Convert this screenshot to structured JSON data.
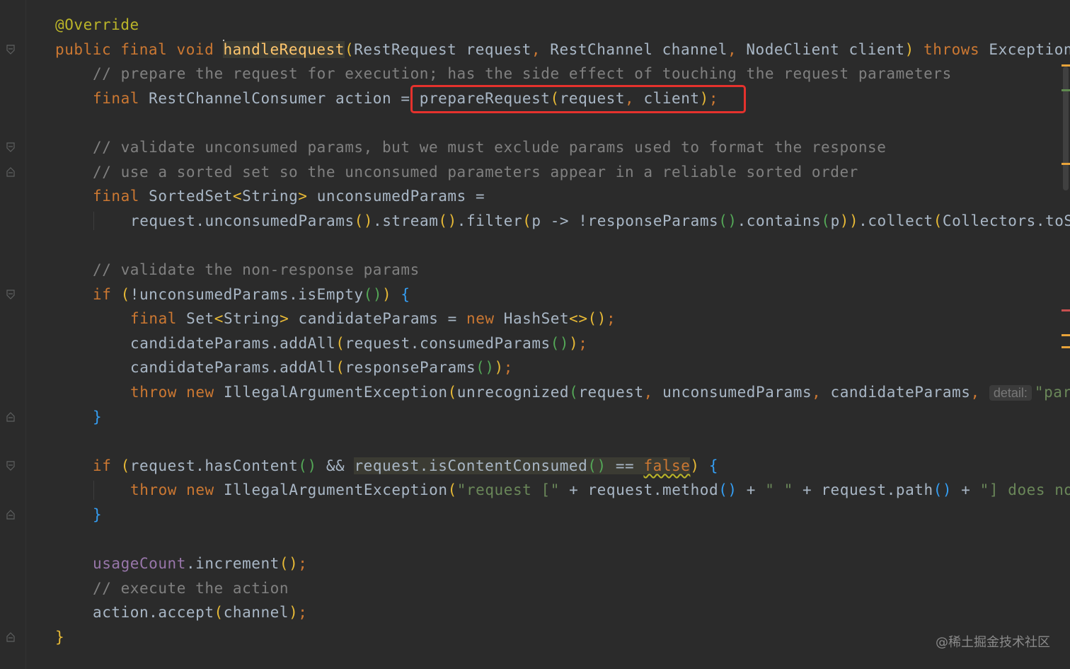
{
  "editor": {
    "lines": [
      {
        "indent": 0,
        "tokens": [
          {
            "t": "@Override",
            "c": "ann"
          }
        ]
      },
      {
        "indent": 0,
        "tokens": [
          {
            "t": "public final void ",
            "c": "kw"
          },
          {
            "t": "",
            "c": "caret"
          },
          {
            "t": "handleRequest",
            "c": "fn sel"
          },
          {
            "t": "(",
            "c": "p1"
          },
          {
            "t": "RestRequest request",
            "c": ""
          },
          {
            "t": ", ",
            "c": "kw"
          },
          {
            "t": "RestChannel channel",
            "c": ""
          },
          {
            "t": ", ",
            "c": "kw"
          },
          {
            "t": "NodeClient client",
            "c": ""
          },
          {
            "t": ") ",
            "c": "p1"
          },
          {
            "t": "throws ",
            "c": "kw"
          },
          {
            "t": "Exception",
            "c": ""
          }
        ]
      },
      {
        "indent": 1,
        "tokens": [
          {
            "t": "// prepare the request for execution; has the side effect of touching the request parameters",
            "c": "cm"
          }
        ]
      },
      {
        "indent": 1,
        "tokens": [
          {
            "t": "final ",
            "c": "kw"
          },
          {
            "t": "RestChannelConsumer action = ",
            "c": ""
          },
          {
            "t": "prepareRequest",
            "c": ""
          },
          {
            "t": "(",
            "c": "p1"
          },
          {
            "t": "request",
            "c": ""
          },
          {
            "t": ", ",
            "c": "kw"
          },
          {
            "t": "client",
            "c": ""
          },
          {
            "t": ")",
            "c": "p1"
          },
          {
            "t": ";",
            "c": "kw"
          }
        ]
      },
      {
        "indent": 0,
        "tokens": []
      },
      {
        "indent": 1,
        "tokens": [
          {
            "t": "// validate unconsumed params, but we must exclude params used to format the response",
            "c": "cm"
          }
        ]
      },
      {
        "indent": 1,
        "tokens": [
          {
            "t": "// use a sorted set so the unconsumed parameters appear in a reliable sorted order",
            "c": "cm"
          }
        ]
      },
      {
        "indent": 1,
        "tokens": [
          {
            "t": "final ",
            "c": "kw"
          },
          {
            "t": "SortedSet",
            "c": ""
          },
          {
            "t": "<",
            "c": "p1"
          },
          {
            "t": "String",
            "c": ""
          },
          {
            "t": ">",
            "c": "p1"
          },
          {
            "t": " unconsumedParams =",
            "c": ""
          }
        ]
      },
      {
        "indent": 2,
        "tokens": [
          {
            "t": "request.unconsumedParams",
            "c": ""
          },
          {
            "t": "()",
            "c": "p1"
          },
          {
            "t": ".stream",
            "c": ""
          },
          {
            "t": "()",
            "c": "p1"
          },
          {
            "t": ".filter",
            "c": ""
          },
          {
            "t": "(",
            "c": "p1"
          },
          {
            "t": "p -> !responseParams",
            "c": ""
          },
          {
            "t": "()",
            "c": "p2"
          },
          {
            "t": ".contains",
            "c": ""
          },
          {
            "t": "(",
            "c": "p2"
          },
          {
            "t": "p",
            "c": ""
          },
          {
            "t": "))",
            "c": "p1"
          },
          {
            "t": ".collect",
            "c": ""
          },
          {
            "t": "(",
            "c": "p1"
          },
          {
            "t": "Collectors.toSortedSet",
            "c": ""
          }
        ]
      },
      {
        "indent": 0,
        "tokens": []
      },
      {
        "indent": 1,
        "tokens": [
          {
            "t": "// validate the non-response params",
            "c": "cm"
          }
        ]
      },
      {
        "indent": 1,
        "tokens": [
          {
            "t": "if ",
            "c": "kw"
          },
          {
            "t": "(",
            "c": "p1"
          },
          {
            "t": "!unconsumedParams.isEmpty",
            "c": ""
          },
          {
            "t": "()",
            "c": "p2"
          },
          {
            "t": ")",
            "c": "p1"
          },
          {
            "t": " ",
            "c": ""
          },
          {
            "t": "{",
            "c": "p3"
          }
        ]
      },
      {
        "indent": 2,
        "tokens": [
          {
            "t": "final ",
            "c": "kw"
          },
          {
            "t": "Set",
            "c": ""
          },
          {
            "t": "<",
            "c": "p1"
          },
          {
            "t": "String",
            "c": ""
          },
          {
            "t": ">",
            "c": "p1"
          },
          {
            "t": " candidateParams = ",
            "c": ""
          },
          {
            "t": "new ",
            "c": "kw"
          },
          {
            "t": "HashSet",
            "c": ""
          },
          {
            "t": "<>",
            "c": "p1"
          },
          {
            "t": "()",
            "c": "p1"
          },
          {
            "t": ";",
            "c": "kw"
          }
        ]
      },
      {
        "indent": 2,
        "tokens": [
          {
            "t": "candidateParams.addAll",
            "c": ""
          },
          {
            "t": "(",
            "c": "p1"
          },
          {
            "t": "request.consumedParams",
            "c": ""
          },
          {
            "t": "()",
            "c": "p2"
          },
          {
            "t": ")",
            "c": "p1"
          },
          {
            "t": ";",
            "c": "kw"
          }
        ]
      },
      {
        "indent": 2,
        "tokens": [
          {
            "t": "candidateParams.addAll",
            "c": ""
          },
          {
            "t": "(",
            "c": "p1"
          },
          {
            "t": "responseParams",
            "c": ""
          },
          {
            "t": "()",
            "c": "p2"
          },
          {
            "t": ")",
            "c": "p1"
          },
          {
            "t": ";",
            "c": "kw"
          }
        ]
      },
      {
        "indent": 2,
        "tokens": [
          {
            "t": "throw new ",
            "c": "kw"
          },
          {
            "t": "IllegalArgumentException",
            "c": ""
          },
          {
            "t": "(",
            "c": "p1"
          },
          {
            "t": "unrecognized",
            "c": ""
          },
          {
            "t": "(",
            "c": "p2"
          },
          {
            "t": "request",
            "c": ""
          },
          {
            "t": ", ",
            "c": "kw"
          },
          {
            "t": "unconsumedParams",
            "c": ""
          },
          {
            "t": ", ",
            "c": "kw"
          },
          {
            "t": "candidateParams",
            "c": ""
          },
          {
            "t": ", ",
            "c": "kw"
          },
          {
            "t": "detail:",
            "c": "hint"
          },
          {
            "t": "\"parameter\"",
            "c": "str"
          }
        ]
      },
      {
        "indent": 1,
        "tokens": [
          {
            "t": "}",
            "c": "p3"
          }
        ]
      },
      {
        "indent": 0,
        "tokens": []
      },
      {
        "indent": 1,
        "tokens": [
          {
            "t": "if ",
            "c": "kw"
          },
          {
            "t": "(",
            "c": "p1"
          },
          {
            "t": "request.hasContent",
            "c": ""
          },
          {
            "t": "()",
            "c": "p2"
          },
          {
            "t": " && ",
            "c": ""
          },
          {
            "t": "request.isContentConsumed",
            "c": "sel"
          },
          {
            "t": "()",
            "c": "p2 sel"
          },
          {
            "t": " == ",
            "c": "sel"
          },
          {
            "t": "false",
            "c": "warn sel"
          },
          {
            "t": ")",
            "c": "p1"
          },
          {
            "t": " ",
            "c": ""
          },
          {
            "t": "{",
            "c": "p3"
          }
        ]
      },
      {
        "indent": 2,
        "tokens": [
          {
            "t": "throw new ",
            "c": "kw"
          },
          {
            "t": "IllegalArgumentException",
            "c": ""
          },
          {
            "t": "(",
            "c": "p1"
          },
          {
            "t": "\"request [\"",
            "c": "str"
          },
          {
            "t": " + request.method",
            "c": ""
          },
          {
            "t": "()",
            "c": "p3"
          },
          {
            "t": " + ",
            "c": ""
          },
          {
            "t": "\" \"",
            "c": "str"
          },
          {
            "t": " + request.path",
            "c": ""
          },
          {
            "t": "()",
            "c": "p3"
          },
          {
            "t": " + ",
            "c": ""
          },
          {
            "t": "\"] does not support having a body\"",
            "c": "str"
          }
        ]
      },
      {
        "indent": 1,
        "tokens": [
          {
            "t": "}",
            "c": "p3"
          }
        ]
      },
      {
        "indent": 0,
        "tokens": []
      },
      {
        "indent": 1,
        "tokens": [
          {
            "t": "usageCount",
            "c": "fld"
          },
          {
            "t": ".increment",
            "c": ""
          },
          {
            "t": "()",
            "c": "p1"
          },
          {
            "t": ";",
            "c": "kw"
          }
        ]
      },
      {
        "indent": 1,
        "tokens": [
          {
            "t": "// execute the action",
            "c": "cm"
          }
        ]
      },
      {
        "indent": 1,
        "tokens": [
          {
            "t": "action.accept",
            "c": ""
          },
          {
            "t": "(",
            "c": "p1"
          },
          {
            "t": "channel",
            "c": ""
          },
          {
            "t": ")",
            "c": "p1"
          },
          {
            "t": ";",
            "c": "kw"
          }
        ]
      },
      {
        "indent": 0,
        "tokens": [
          {
            "t": "}",
            "c": "p1"
          }
        ]
      }
    ]
  },
  "fold_markers": [
    {
      "line": 1,
      "kind": "open"
    },
    {
      "line": 5,
      "kind": "open"
    },
    {
      "line": 6,
      "kind": "close"
    },
    {
      "line": 11,
      "kind": "open"
    },
    {
      "line": 16,
      "kind": "close"
    },
    {
      "line": 18,
      "kind": "open"
    },
    {
      "line": 20,
      "kind": "close"
    },
    {
      "line": 25,
      "kind": "close"
    }
  ],
  "scroll_markers": [
    {
      "line": 2,
      "color": "#e8a33a"
    },
    {
      "line": 3,
      "color": "#5f8a4f"
    },
    {
      "line": 6,
      "color": "#e8a33a"
    },
    {
      "line": 12,
      "color": "#c74f4f"
    },
    {
      "line": 13,
      "color": "#e8a33a"
    },
    {
      "line": 13.5,
      "color": "#e8a33a"
    }
  ],
  "watermark": "@稀土掘金技术社区",
  "colors": {
    "background": "#2b2b2b",
    "highlight_box": "#e5322d"
  }
}
